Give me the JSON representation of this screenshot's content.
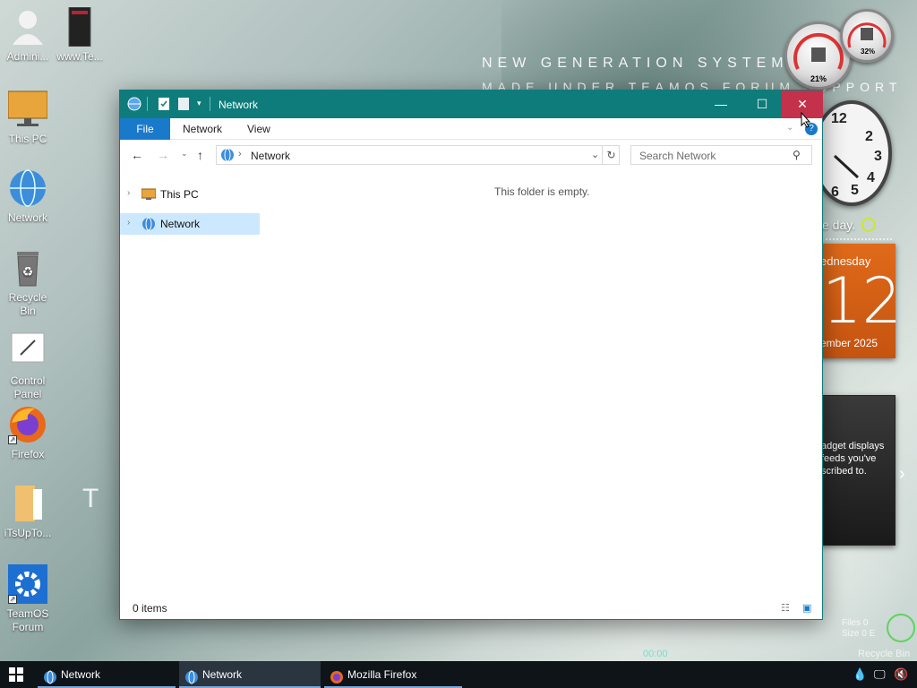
{
  "wallpaper": {
    "line1": "NEW GENERATION SYSTEM",
    "line2": "MADE UNDER TEAMOS FORUM SUPPORT",
    "big_text": "T O"
  },
  "desktop_icons": [
    {
      "label": "Admini..."
    },
    {
      "label": "www.Te..."
    },
    {
      "label": "This PC"
    },
    {
      "label": "Network"
    },
    {
      "label": "Recycle Bin"
    },
    {
      "label": "Control Panel"
    },
    {
      "label": "Firefox"
    },
    {
      "label": "iTsUpTo..."
    },
    {
      "label": "TeamOS Forum"
    }
  ],
  "gadgets": {
    "gauge_cpu": "21%",
    "gauge_mem": "32%",
    "clock_numbers": [
      "12",
      "2",
      "3",
      "4",
      "5",
      "6"
    ],
    "greeting": "e day.",
    "calendar_day": "ednesday",
    "calendar_date": "12",
    "calendar_month": "ember 2025",
    "feed_lines": [
      "adget displays",
      "feeds you've",
      "scribed to."
    ],
    "recycle_stats": [
      "Files 0",
      "Size 0 E"
    ],
    "recycle_label": "Recycle Bin",
    "cyan_text": "00:00"
  },
  "window": {
    "title": "Network",
    "ribbon_tabs": [
      "File",
      "Network",
      "View"
    ],
    "address_path": "Network",
    "search_placeholder": "Search Network",
    "nav_tree": [
      {
        "label": "This PC",
        "selected": false
      },
      {
        "label": "Network",
        "selected": true
      }
    ],
    "empty_message": "This folder is empty.",
    "status_items": "0 items",
    "colors": {
      "titlebar": "#0e7c7b",
      "file_tab": "#1979ca",
      "close_hover": "#c4314b",
      "selection": "#cce8ff"
    }
  },
  "taskbar": {
    "items": [
      {
        "label": "Network",
        "icon": "network-icon"
      },
      {
        "label": "Network",
        "icon": "network-icon",
        "active": true
      },
      {
        "label": "Mozilla Firefox",
        "icon": "firefox-icon"
      }
    ]
  }
}
